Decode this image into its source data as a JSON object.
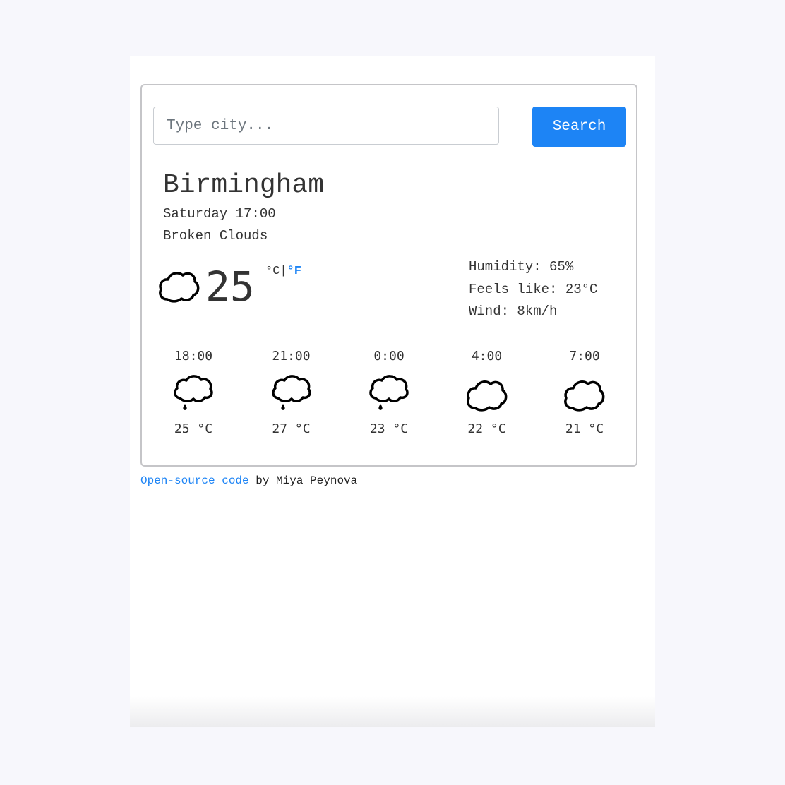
{
  "search": {
    "placeholder": "Type city...",
    "value": "",
    "button_label": "Search"
  },
  "current": {
    "city": "Birmingham",
    "datetime": "Saturday 17:00",
    "description": "Broken Clouds",
    "icon": "cloud-icon",
    "temperature": "25",
    "unit_celsius": "°C",
    "unit_separator": "|",
    "unit_fahrenheit": "°F",
    "humidity": "Humidity: 65%",
    "feels_like": "Feels like: 23°C",
    "wind": "Wind: 8km/h"
  },
  "forecast": [
    {
      "time": "18:00",
      "icon": "cloud-rain-icon",
      "temp": "25 °C"
    },
    {
      "time": "21:00",
      "icon": "cloud-rain-icon",
      "temp": "27 °C"
    },
    {
      "time": "0:00",
      "icon": "cloud-rain-icon",
      "temp": "23 °C"
    },
    {
      "time": "4:00",
      "icon": "cloud-icon",
      "temp": "22 °C"
    },
    {
      "time": "7:00",
      "icon": "cloud-icon",
      "temp": "21 °C"
    }
  ],
  "footer": {
    "link_label": "Open-source code",
    "suffix": " by Miya Peynova"
  },
  "colors": {
    "accent": "#1d84f5",
    "text": "#333333",
    "background": "#f7f7fc"
  }
}
